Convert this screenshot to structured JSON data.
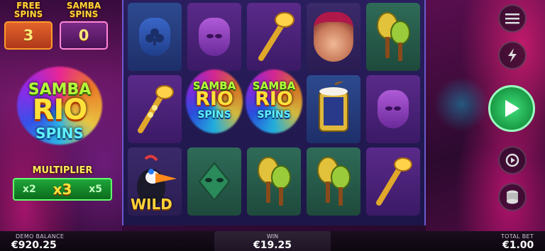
{
  "counters": {
    "free_spins": {
      "label": "FREE SPINS",
      "value": "3"
    },
    "samba_spins": {
      "label": "SAMBA SPINS",
      "value": "0"
    }
  },
  "logo": {
    "line1": "SAMBA",
    "line2": "RIO",
    "line3": "SPINS"
  },
  "multiplier": {
    "title": "MULTIPLIER",
    "options": [
      "x2",
      "x3",
      "x5"
    ],
    "active": "x3"
  },
  "reels": [
    {
      "col": 0,
      "symbols": [
        "blue-club-mask",
        "golden-trumpet",
        "toucan-wild"
      ]
    },
    {
      "col": 1,
      "symbols": [
        "purple-heart-mask",
        "samba-rio-spins-bonus",
        "green-diamond-mask"
      ]
    },
    {
      "col": 2,
      "symbols": [
        "golden-trumpet",
        "samba-rio-spins-bonus",
        "maracas"
      ]
    },
    {
      "col": 3,
      "symbols": [
        "samba-dancer",
        "drum",
        "maracas"
      ]
    },
    {
      "col": 4,
      "symbols": [
        "maracas",
        "purple-heart-mask",
        "golden-trumpet"
      ]
    }
  ],
  "wild_label": "WILD",
  "bonus_text": {
    "line1": "SAMBA",
    "line2": "RIO",
    "line3": "SPINS"
  },
  "controls": [
    "menu-icon",
    "turbo-lightning-icon",
    "spin-play-icon",
    "autoplay-icon",
    "bet-coins-icon"
  ],
  "footer": {
    "balance_label": "DEMO BALANCE",
    "balance_value": "€920.25",
    "win_label": "WIN",
    "win_value": "€19.25",
    "bet_label": "TOTAL BET",
    "bet_value": "€1.00"
  },
  "colors": {
    "accent_gold": "#ffe13a",
    "spin_green": "#1a9a45",
    "multiplier_green": "#1fa63a"
  }
}
